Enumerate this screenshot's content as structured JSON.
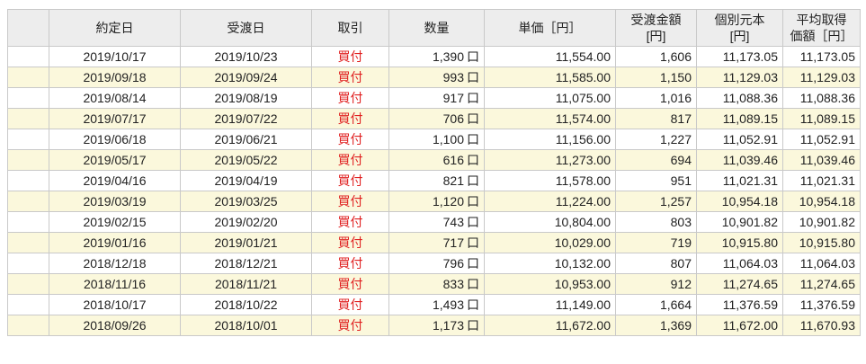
{
  "table": {
    "headers": {
      "blank": "",
      "contract_date": "約定日",
      "settlement_date": "受渡日",
      "trade": "取引",
      "quantity": "数量",
      "unit_price": "単価［円］",
      "settlement_amount_line1": "受渡金額",
      "settlement_amount_line2": "[円]",
      "cost_basis_line1": "個別元本",
      "cost_basis_line2": "[円]",
      "avg_cost_line1": "平均取得",
      "avg_cost_line2": "価額［円］"
    },
    "unit_label": "口",
    "trade_color": "#e02020",
    "row_colors": [
      "#ffffff",
      "#fbf8dc"
    ],
    "rows": [
      {
        "contract_date": "2019/10/17",
        "settlement_date": "2019/10/23",
        "trade": "買付",
        "quantity": "1,390",
        "unit_price": "11,554.00",
        "amount": "1,606",
        "cost_basis": "11,173.05",
        "avg_cost": "11,173.05"
      },
      {
        "contract_date": "2019/09/18",
        "settlement_date": "2019/09/24",
        "trade": "買付",
        "quantity": "993",
        "unit_price": "11,585.00",
        "amount": "1,150",
        "cost_basis": "11,129.03",
        "avg_cost": "11,129.03"
      },
      {
        "contract_date": "2019/08/14",
        "settlement_date": "2019/08/19",
        "trade": "買付",
        "quantity": "917",
        "unit_price": "11,075.00",
        "amount": "1,016",
        "cost_basis": "11,088.36",
        "avg_cost": "11,088.36"
      },
      {
        "contract_date": "2019/07/17",
        "settlement_date": "2019/07/22",
        "trade": "買付",
        "quantity": "706",
        "unit_price": "11,574.00",
        "amount": "817",
        "cost_basis": "11,089.15",
        "avg_cost": "11,089.15"
      },
      {
        "contract_date": "2019/06/18",
        "settlement_date": "2019/06/21",
        "trade": "買付",
        "quantity": "1,100",
        "unit_price": "11,156.00",
        "amount": "1,227",
        "cost_basis": "11,052.91",
        "avg_cost": "11,052.91"
      },
      {
        "contract_date": "2019/05/17",
        "settlement_date": "2019/05/22",
        "trade": "買付",
        "quantity": "616",
        "unit_price": "11,273.00",
        "amount": "694",
        "cost_basis": "11,039.46",
        "avg_cost": "11,039.46"
      },
      {
        "contract_date": "2019/04/16",
        "settlement_date": "2019/04/19",
        "trade": "買付",
        "quantity": "821",
        "unit_price": "11,578.00",
        "amount": "951",
        "cost_basis": "11,021.31",
        "avg_cost": "11,021.31"
      },
      {
        "contract_date": "2019/03/19",
        "settlement_date": "2019/03/25",
        "trade": "買付",
        "quantity": "1,120",
        "unit_price": "11,224.00",
        "amount": "1,257",
        "cost_basis": "10,954.18",
        "avg_cost": "10,954.18"
      },
      {
        "contract_date": "2019/02/15",
        "settlement_date": "2019/02/20",
        "trade": "買付",
        "quantity": "743",
        "unit_price": "10,804.00",
        "amount": "803",
        "cost_basis": "10,901.82",
        "avg_cost": "10,901.82"
      },
      {
        "contract_date": "2019/01/16",
        "settlement_date": "2019/01/21",
        "trade": "買付",
        "quantity": "717",
        "unit_price": "10,029.00",
        "amount": "719",
        "cost_basis": "10,915.80",
        "avg_cost": "10,915.80"
      },
      {
        "contract_date": "2018/12/18",
        "settlement_date": "2018/12/21",
        "trade": "買付",
        "quantity": "796",
        "unit_price": "10,132.00",
        "amount": "807",
        "cost_basis": "11,064.03",
        "avg_cost": "11,064.03"
      },
      {
        "contract_date": "2018/11/16",
        "settlement_date": "2018/11/21",
        "trade": "買付",
        "quantity": "833",
        "unit_price": "10,953.00",
        "amount": "912",
        "cost_basis": "11,274.65",
        "avg_cost": "11,274.65"
      },
      {
        "contract_date": "2018/10/17",
        "settlement_date": "2018/10/22",
        "trade": "買付",
        "quantity": "1,493",
        "unit_price": "11,149.00",
        "amount": "1,664",
        "cost_basis": "11,376.59",
        "avg_cost": "11,376.59"
      },
      {
        "contract_date": "2018/09/26",
        "settlement_date": "2018/10/01",
        "trade": "買付",
        "quantity": "1,173",
        "unit_price": "11,672.00",
        "amount": "1,369",
        "cost_basis": "11,672.00",
        "avg_cost": "11,670.93"
      }
    ]
  }
}
